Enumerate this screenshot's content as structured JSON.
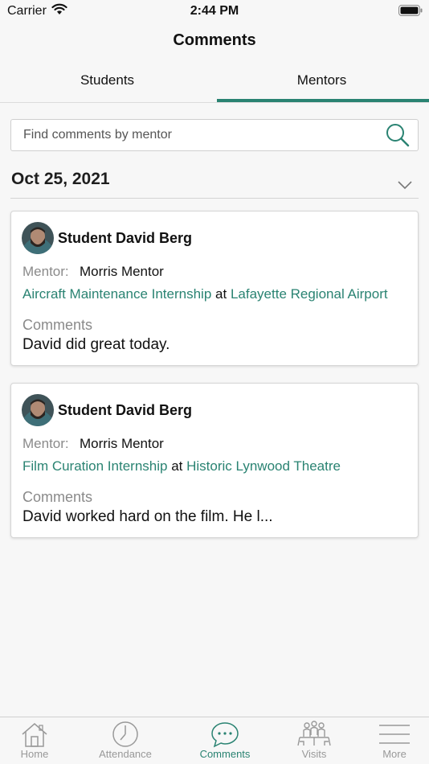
{
  "status": {
    "carrier": "Carrier",
    "time": "2:44 PM"
  },
  "nav": {
    "title": "Comments"
  },
  "tabs": [
    {
      "label": "Students",
      "selected": false
    },
    {
      "label": "Mentors",
      "selected": true
    }
  ],
  "search": {
    "placeholder": "Find comments by mentor",
    "value": ""
  },
  "date_group": {
    "label": "Oct 25, 2021"
  },
  "cards": [
    {
      "student_name": "Student David Berg",
      "mentor_label": "Mentor:",
      "mentor_name": "Morris Mentor",
      "internship": "Aircraft Maintenance Internship",
      "at": "at",
      "location": "Lafayette Regional Airport",
      "comments_label": "Comments",
      "comment": "David did great today."
    },
    {
      "student_name": "Student David Berg",
      "mentor_label": "Mentor:",
      "mentor_name": "Morris Mentor",
      "internship": "Film Curation Internship",
      "at": "at",
      "location": "Historic Lynwood Theatre",
      "comments_label": "Comments",
      "comment": "David worked hard on the film. He l..."
    }
  ],
  "tab_bar": [
    {
      "label": "Home",
      "icon": "home-icon",
      "active": false
    },
    {
      "label": "Attendance",
      "icon": "clock-icon",
      "active": false
    },
    {
      "label": "Comments",
      "icon": "chat-bubble-icon",
      "active": true
    },
    {
      "label": "Visits",
      "icon": "meeting-icon",
      "active": false
    },
    {
      "label": "More",
      "icon": "menu-icon",
      "active": false
    }
  ],
  "colors": {
    "accent": "#2a8372",
    "inactive": "#999999",
    "background": "#f7f7f7"
  }
}
